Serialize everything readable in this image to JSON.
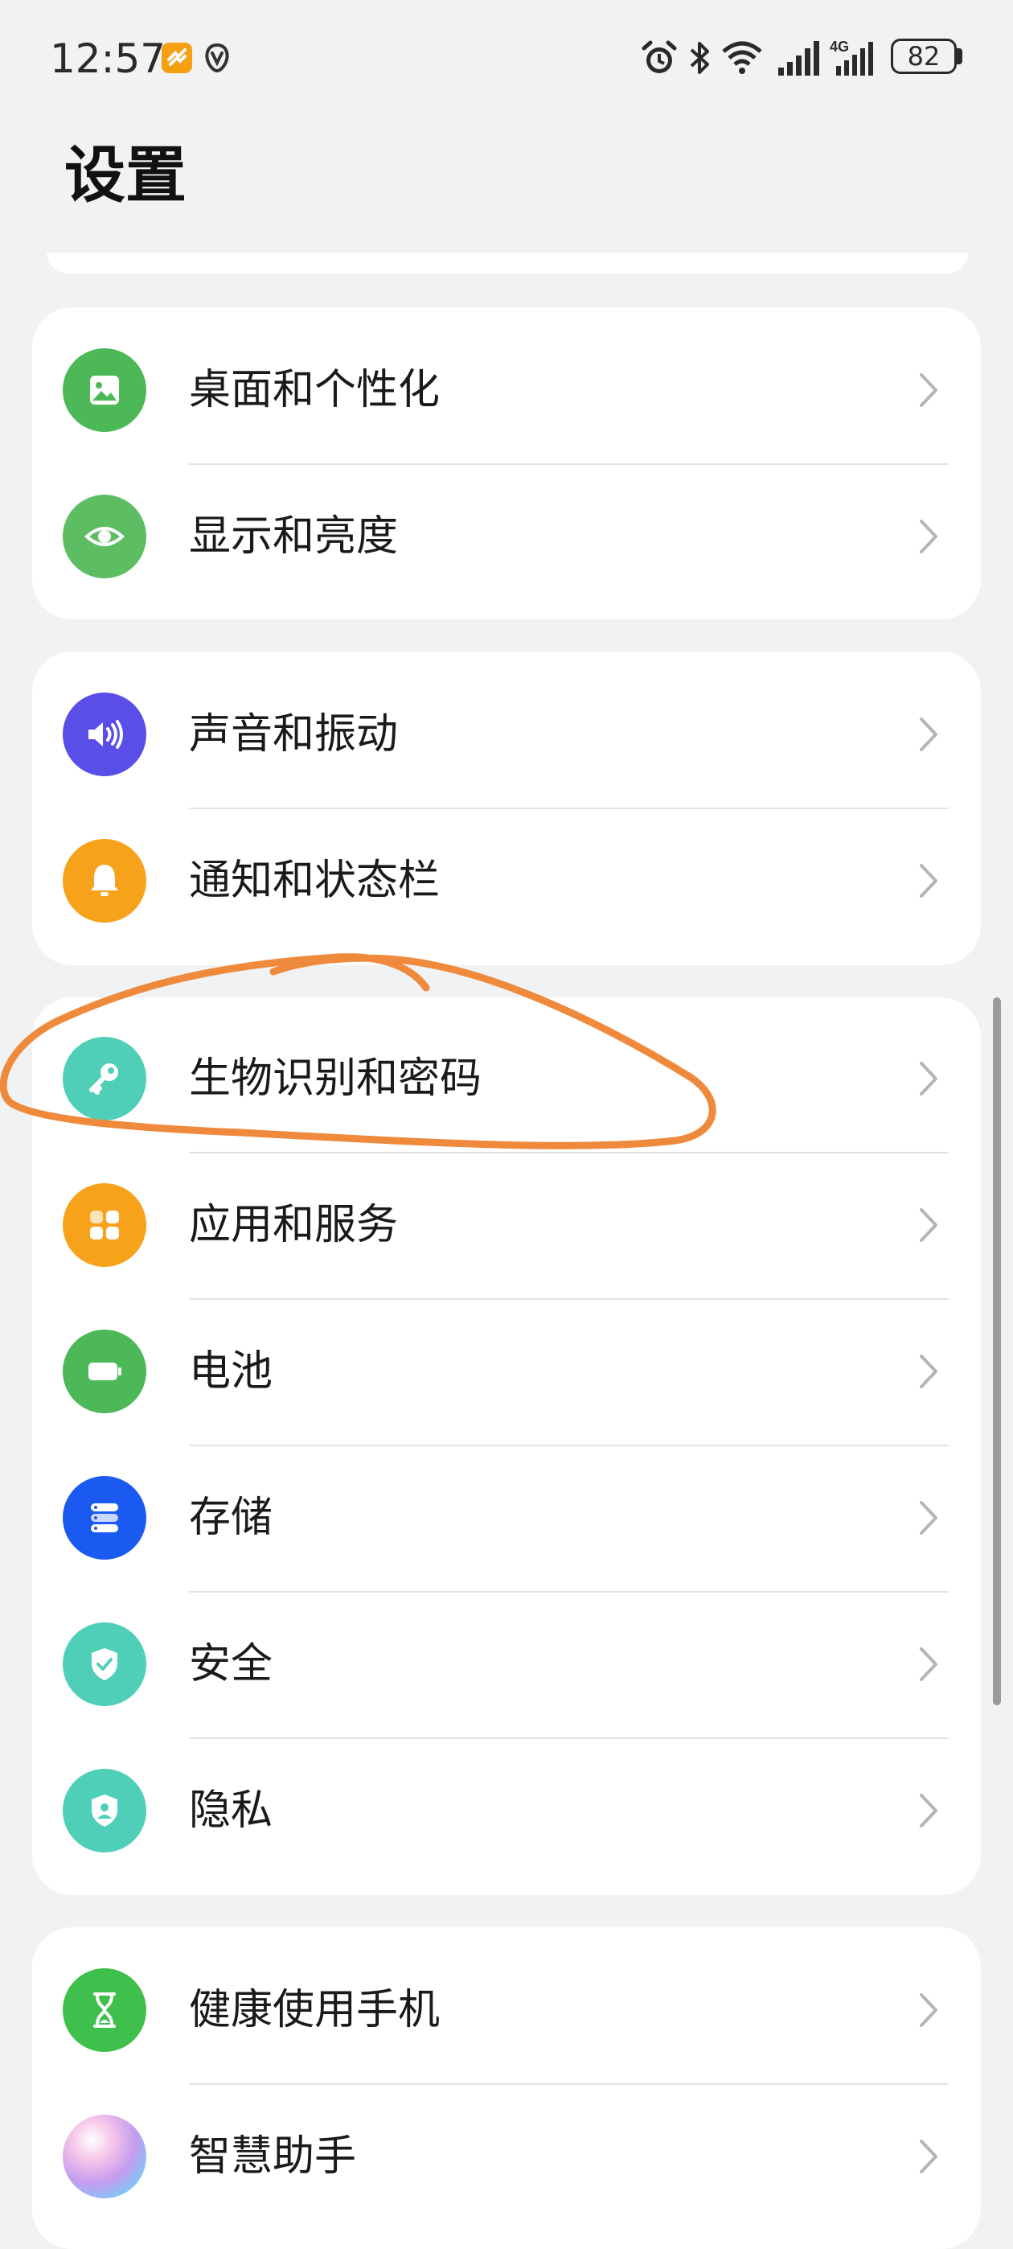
{
  "status_bar": {
    "time": "12:57",
    "battery": "82",
    "icons": [
      "app-notification-icon",
      "app-notification-icon-2",
      "alarm-icon",
      "bluetooth-icon",
      "wifi-icon",
      "signal-icon",
      "4g-signal-icon",
      "battery-icon"
    ]
  },
  "page": {
    "title": "设置"
  },
  "groups": [
    {
      "items": [
        {
          "label": "桌面和个性化",
          "icon": "wallpaper-icon",
          "color": "#4cb858"
        },
        {
          "label": "显示和亮度",
          "icon": "eye-icon",
          "color": "#5cbd62"
        }
      ]
    },
    {
      "items": [
        {
          "label": "声音和振动",
          "icon": "speaker-icon",
          "color": "#5a4ee8"
        },
        {
          "label": "通知和状态栏",
          "icon": "bell-icon",
          "color": "#f7a21b"
        }
      ]
    },
    {
      "items": [
        {
          "label": "生物识别和密码",
          "icon": "key-icon",
          "color": "#4fcfb8"
        },
        {
          "label": "应用和服务",
          "icon": "apps-icon",
          "color": "#f7a21b"
        },
        {
          "label": "电池",
          "icon": "battery-icon",
          "color": "#4cb858"
        },
        {
          "label": "存储",
          "icon": "storage-icon",
          "color": "#1a5af0"
        },
        {
          "label": "安全",
          "icon": "shield-check-icon",
          "color": "#4fcfb8"
        },
        {
          "label": "隐私",
          "icon": "privacy-shield-icon",
          "color": "#4fcfb8"
        }
      ]
    },
    {
      "items": [
        {
          "label": "健康使用手机",
          "icon": "hourglass-icon",
          "color": "#3fbf4c"
        },
        {
          "label": "智慧助手",
          "icon": "assistant-orb-icon",
          "color": "#c49cf0"
        }
      ]
    }
  ],
  "annotation": {
    "color": "#ef8a3c"
  }
}
